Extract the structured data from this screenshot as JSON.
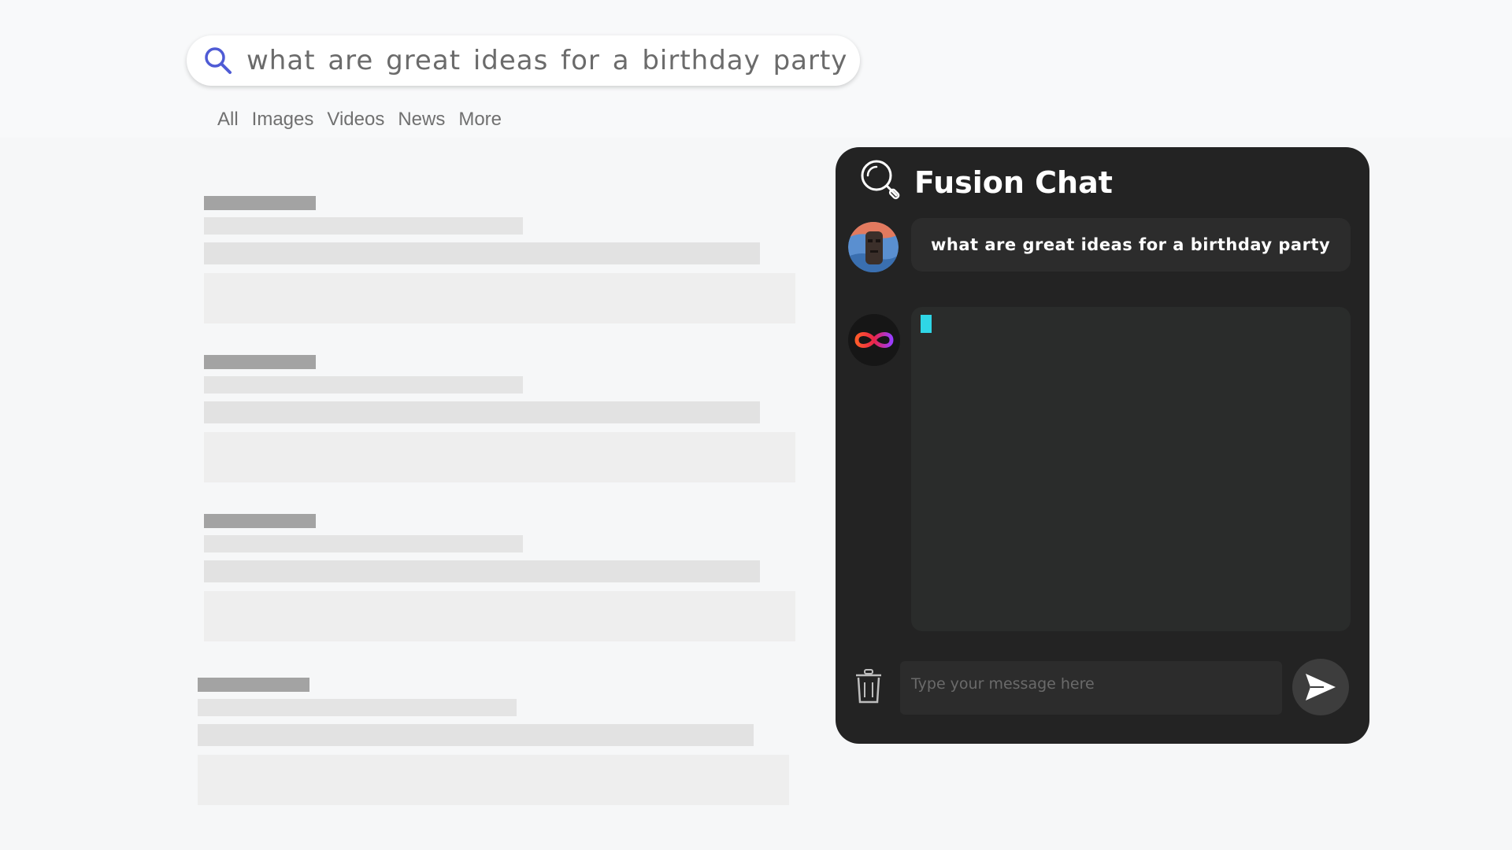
{
  "search": {
    "query": "what are great ideas for a birthday party"
  },
  "tabs": [
    "All",
    "Images",
    "Videos",
    "News",
    "More"
  ],
  "chat": {
    "title": "Fusion Chat",
    "user_message": "what are great ideas for a birthday party",
    "input_placeholder": "Type your message here",
    "colors": {
      "panel": "#232323",
      "cursor": "#2fd6e6",
      "search_icon": "#4f5bd5"
    },
    "icons": {
      "header": "magnifier-icon",
      "bot": "infinity-logo-icon",
      "delete": "trash-icon",
      "send": "send-icon"
    }
  }
}
